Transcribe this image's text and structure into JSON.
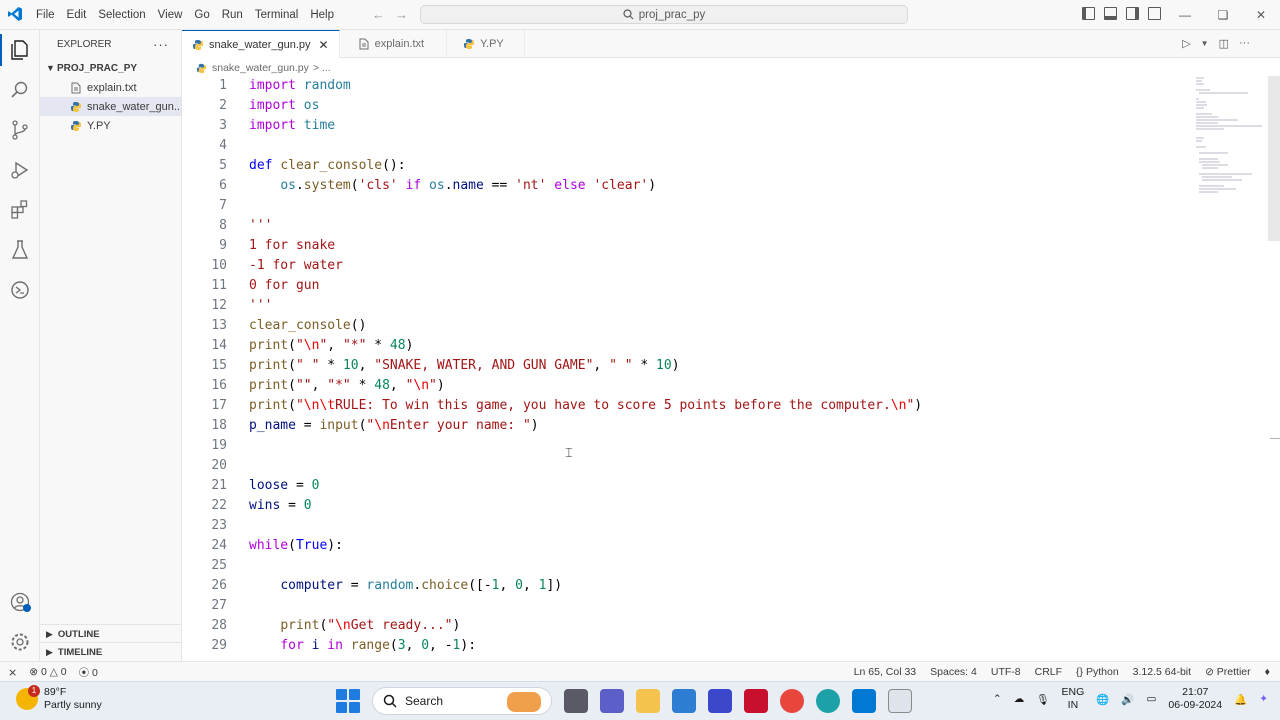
{
  "titlebar": {
    "menu": [
      "File",
      "Edit",
      "Selection",
      "View",
      "Go",
      "Run",
      "Terminal",
      "Help"
    ],
    "search_text": "proj_prac_py"
  },
  "sidebar": {
    "title": "EXPLORER",
    "folder": "PROJ_PRAC_PY",
    "files": [
      {
        "name": "explain.txt",
        "icon": "text-file-icon"
      },
      {
        "name": "snake_water_gun....",
        "icon": "python-icon"
      },
      {
        "name": "Y.PY",
        "icon": "python-icon"
      }
    ],
    "outline": "OUTLINE",
    "timeline": "TIMELINE"
  },
  "tabs": [
    {
      "label": "snake_water_gun.py",
      "active": true
    },
    {
      "label": "explain.txt",
      "active": false
    },
    {
      "label": "Y.PY",
      "active": false
    }
  ],
  "breadcrumb": {
    "file": "snake_water_gun.py",
    "more": "> ..."
  },
  "code": {
    "line_numbers": [
      "1",
      "2",
      "3",
      "4",
      "5",
      "6",
      "7",
      "8",
      "9",
      "10",
      "11",
      "12",
      "13",
      "14",
      "15",
      "16",
      "17",
      "18",
      "19",
      "20",
      "21",
      "22",
      "23",
      "24",
      "25",
      "26",
      "27",
      "28",
      "29"
    ],
    "lines": [
      "import random",
      "import os",
      "import time",
      "",
      "def clear_console():",
      "    os.system('cls' if os.name == 'nt' else 'clear')",
      "",
      "'''",
      "1 for snake",
      "-1 for water",
      "0 for gun",
      "'''",
      "clear_console()",
      "print(\"\\n\", \"*\" * 48)",
      "print(\" \" * 10, \"SNAKE, WATER, AND GUN GAME\", \" \" * 10)",
      "print(\"\", \"*\" * 48, \"\\n\")",
      "print(\"\\n\\tRULE: To win this game, you have to score 5 points before the computer.\\n\")",
      "p_name = input(\"\\nEnter your name: \")",
      "",
      "",
      "loose = 0",
      "wins = 0",
      "",
      "while(True):",
      "",
      "    computer = random.choice([-1, 0, 1])",
      "",
      "    print(\"\\nGet ready...\")",
      "    for i in range(3, 0, -1):"
    ]
  },
  "statusbar": {
    "errors": "0",
    "warnings": "0",
    "ports": "0",
    "position": "Ln 65, Col 33",
    "spaces": "Spaces: 4",
    "encoding": "UTF-8",
    "eol": "CRLF",
    "language": "Python",
    "interpreter": "3.12.5 64-bit",
    "formatter": "Prettier"
  },
  "taskbar": {
    "temp": "89°F",
    "weather": "Partly sunny",
    "weather_badge": "1",
    "search": "Search",
    "lang1": "ENG",
    "lang2": "IN",
    "time": "21:07",
    "date": "06-09-2024"
  },
  "colors": {
    "accent": "#005fb8",
    "keyword": "#af00db",
    "string": "#a31515",
    "number": "#098658"
  }
}
